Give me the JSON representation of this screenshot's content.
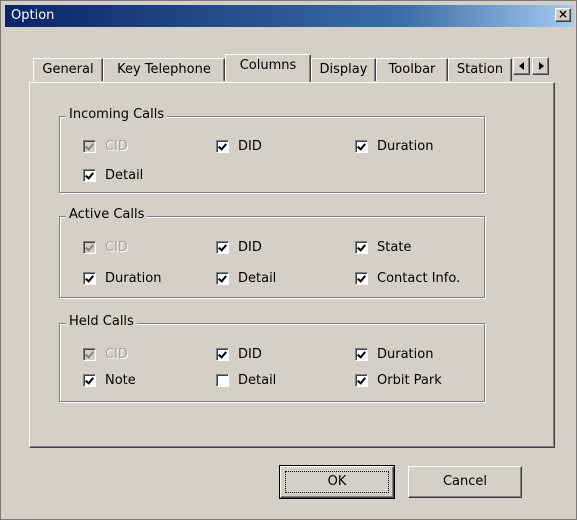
{
  "window": {
    "title": "Option",
    "close_label": "×"
  },
  "tabs": [
    {
      "label": "General",
      "active": false
    },
    {
      "label": "Key Telephone",
      "active": false
    },
    {
      "label": "Columns",
      "active": true
    },
    {
      "label": "Display",
      "active": false
    },
    {
      "label": "Toolbar",
      "active": false
    },
    {
      "label": "Station",
      "active": false
    }
  ],
  "groups": {
    "incoming": {
      "title": "Incoming Calls",
      "items": [
        {
          "label": "CID",
          "checked": true,
          "disabled": true
        },
        {
          "label": "DID",
          "checked": true,
          "disabled": false
        },
        {
          "label": "Duration",
          "checked": true,
          "disabled": false
        },
        {
          "label": "Detail",
          "checked": true,
          "disabled": false
        }
      ]
    },
    "active": {
      "title": "Active Calls",
      "items": [
        {
          "label": "CID",
          "checked": true,
          "disabled": true
        },
        {
          "label": "DID",
          "checked": true,
          "disabled": false
        },
        {
          "label": "State",
          "checked": true,
          "disabled": false
        },
        {
          "label": "Duration",
          "checked": true,
          "disabled": false
        },
        {
          "label": "Detail",
          "checked": true,
          "disabled": false
        },
        {
          "label": "Contact Info.",
          "checked": true,
          "disabled": false
        }
      ]
    },
    "held": {
      "title": "Held Calls",
      "items": [
        {
          "label": "CID",
          "checked": true,
          "disabled": true
        },
        {
          "label": "DID",
          "checked": true,
          "disabled": false
        },
        {
          "label": "Duration",
          "checked": true,
          "disabled": false
        },
        {
          "label": "Note",
          "checked": true,
          "disabled": false
        },
        {
          "label": "Detail",
          "checked": false,
          "disabled": false
        },
        {
          "label": "Orbit Park",
          "checked": true,
          "disabled": false
        }
      ]
    }
  },
  "buttons": {
    "ok": "OK",
    "cancel": "Cancel"
  }
}
